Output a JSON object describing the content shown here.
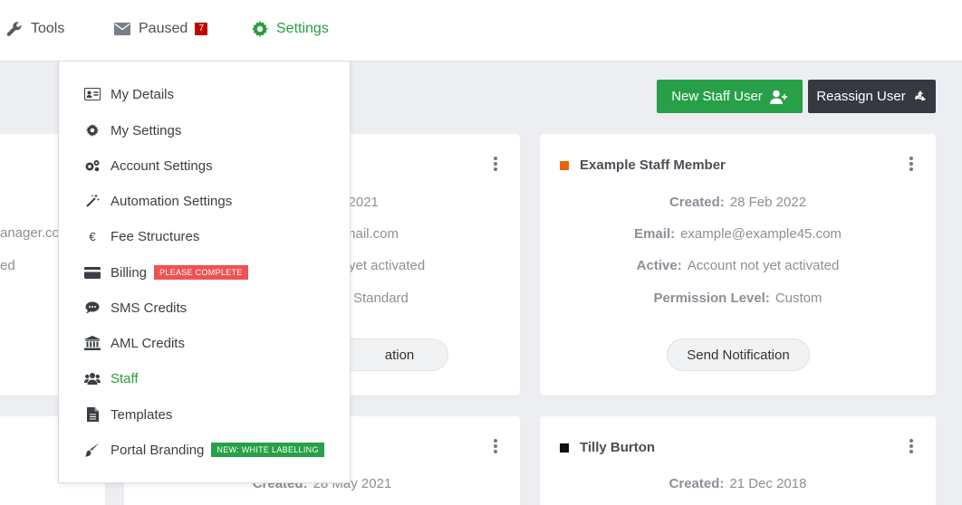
{
  "nav": {
    "tools_label": "Tools",
    "paused_label": "Paused",
    "paused_count": "7",
    "settings_label": "Settings"
  },
  "actions": {
    "new_staff_label": "New Staff User",
    "reassign_label": "Reassign User"
  },
  "colors": {
    "green": "#27a048",
    "dark": "#343a40",
    "orange_swatch": "#e8630a",
    "black_swatch": "#111111",
    "badge_red": "#c00000",
    "tag_red": "#f05252"
  },
  "cards": {
    "card1_frag_email": "anager.co",
    "card1_frag_active": "ed",
    "card2_frag_created": "b 2021",
    "card2_frag_email": "mail.com",
    "card2_frag_active": "yet activated",
    "card2_frag_perm": "Standard",
    "card2_frag_btn": "ation",
    "card3": {
      "name": "Example Staff Member",
      "created_label": "Created:",
      "created": "28 Feb 2022",
      "email_label": "Email:",
      "email": "example@example45.com",
      "active_label": "Active:",
      "active": "Account not yet activated",
      "perm_label": "Permission Level:",
      "perm": "Custom",
      "button": "Send Notification"
    },
    "card5": {
      "created_label": "Created:",
      "created": "28 May 2021"
    },
    "card6": {
      "name": "Tilly Burton",
      "created_label": "Created:",
      "created": "21 Dec 2018"
    }
  },
  "menu": {
    "items": [
      {
        "label": "My Details",
        "icon": "id-card-icon"
      },
      {
        "label": "My Settings",
        "icon": "gear-icon"
      },
      {
        "label": "Account Settings",
        "icon": "gears-icon"
      },
      {
        "label": "Automation Settings",
        "icon": "magic-wand-icon"
      },
      {
        "label": "Fee Structures",
        "icon": "euro-icon"
      },
      {
        "label": "Billing",
        "icon": "credit-card-icon",
        "tag": "PLEASE COMPLETE"
      },
      {
        "label": "SMS Credits",
        "icon": "chat-icon"
      },
      {
        "label": "AML Credits",
        "icon": "bank-icon"
      },
      {
        "label": "Staff",
        "icon": "users-icon",
        "active": true
      },
      {
        "label": "Templates",
        "icon": "document-icon"
      },
      {
        "label": "Portal Branding",
        "icon": "brush-icon",
        "tag": "NEW: WHITE LABELLING"
      }
    ]
  }
}
